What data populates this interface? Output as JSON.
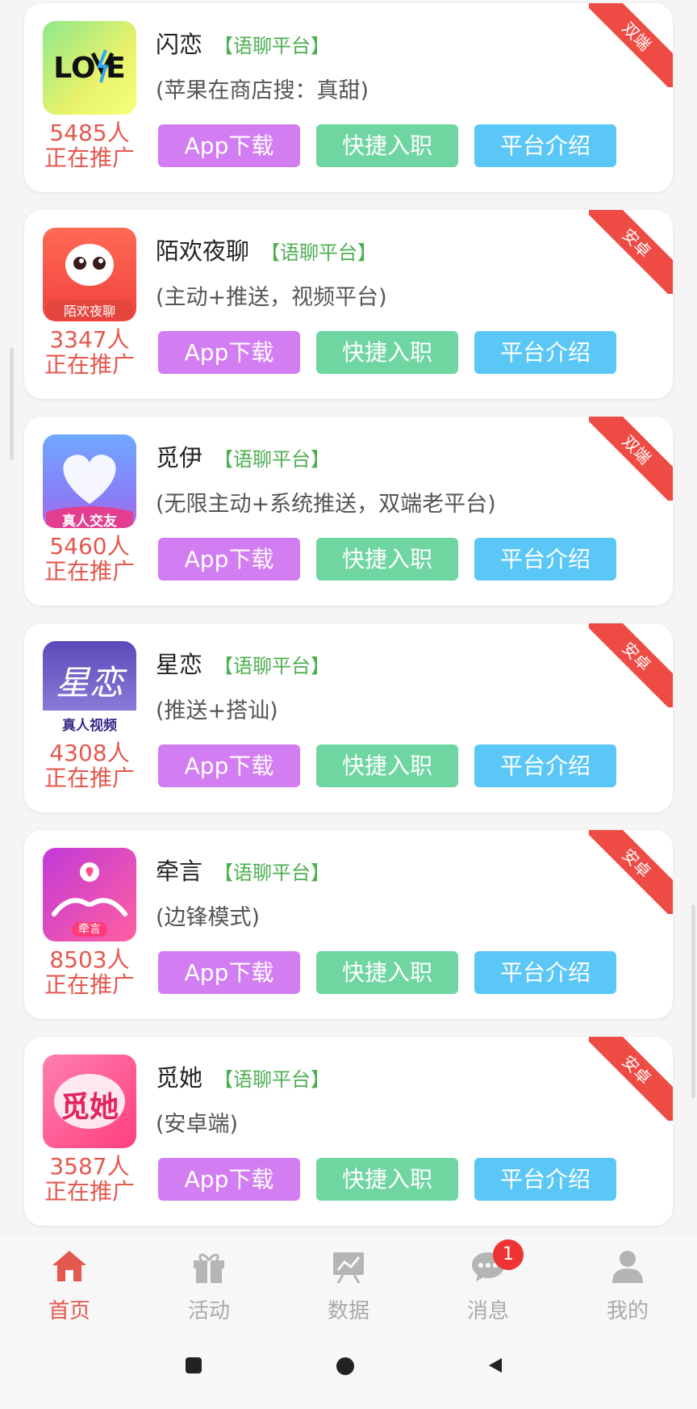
{
  "cards": [
    {
      "name": "闪恋",
      "tag": "【语聊平台】",
      "desc": "(苹果在商店搜：真甜)",
      "count": "5485人",
      "promo": "正在推广",
      "badge": "双端",
      "logo": "love-logo",
      "buttons": {
        "download": "App下载",
        "join": "快捷入职",
        "intro": "平台介绍"
      }
    },
    {
      "name": "陌欢夜聊",
      "tag": "【语聊平台】",
      "desc": "(主动+推送，视频平台)",
      "count": "3347人",
      "promo": "正在推广",
      "badge": "安卓",
      "logo": "mohuan-logo",
      "logo_text": "陌欢夜聊",
      "buttons": {
        "download": "App下载",
        "join": "快捷入职",
        "intro": "平台介绍"
      }
    },
    {
      "name": "觅伊",
      "tag": "【语聊平台】",
      "desc": "(无限主动+系统推送，双端老平台)",
      "count": "5460人",
      "promo": "正在推广",
      "badge": "双端",
      "logo": "miyi-logo",
      "logo_text": "真人交友",
      "buttons": {
        "download": "App下载",
        "join": "快捷入职",
        "intro": "平台介绍"
      }
    },
    {
      "name": "星恋",
      "tag": "【语聊平台】",
      "desc": "(推送+搭讪)",
      "count": "4308人",
      "promo": "正在推广",
      "badge": "安卓",
      "logo": "xinglian-logo",
      "logo_text": "星恋",
      "logo_sub": "真人视频",
      "buttons": {
        "download": "App下载",
        "join": "快捷入职",
        "intro": "平台介绍"
      }
    },
    {
      "name": "牵言",
      "tag": "【语聊平台】",
      "desc": "(边锋模式)",
      "count": "8503人",
      "promo": "正在推广",
      "badge": "安卓",
      "logo": "qianyan-logo",
      "logo_text": "牵言",
      "buttons": {
        "download": "App下载",
        "join": "快捷入职",
        "intro": "平台介绍"
      }
    },
    {
      "name": "觅她",
      "tag": "【语聊平台】",
      "desc": "(安卓端)",
      "count": "3587人",
      "promo": "正在推广",
      "badge": "安卓",
      "logo": "mita-logo",
      "logo_text": "觅她",
      "buttons": {
        "download": "App下载",
        "join": "快捷入职",
        "intro": "平台介绍"
      }
    }
  ],
  "tabbar": {
    "home": "首页",
    "activity": "活动",
    "data": "数据",
    "messages": "消息",
    "messages_badge": "1",
    "mine": "我的"
  },
  "colors": {
    "accent": "#e4584f",
    "download": "#d27ef2",
    "join": "#6fd6a2",
    "intro": "#5ac7f7",
    "ribbon": "#ef4b45"
  }
}
